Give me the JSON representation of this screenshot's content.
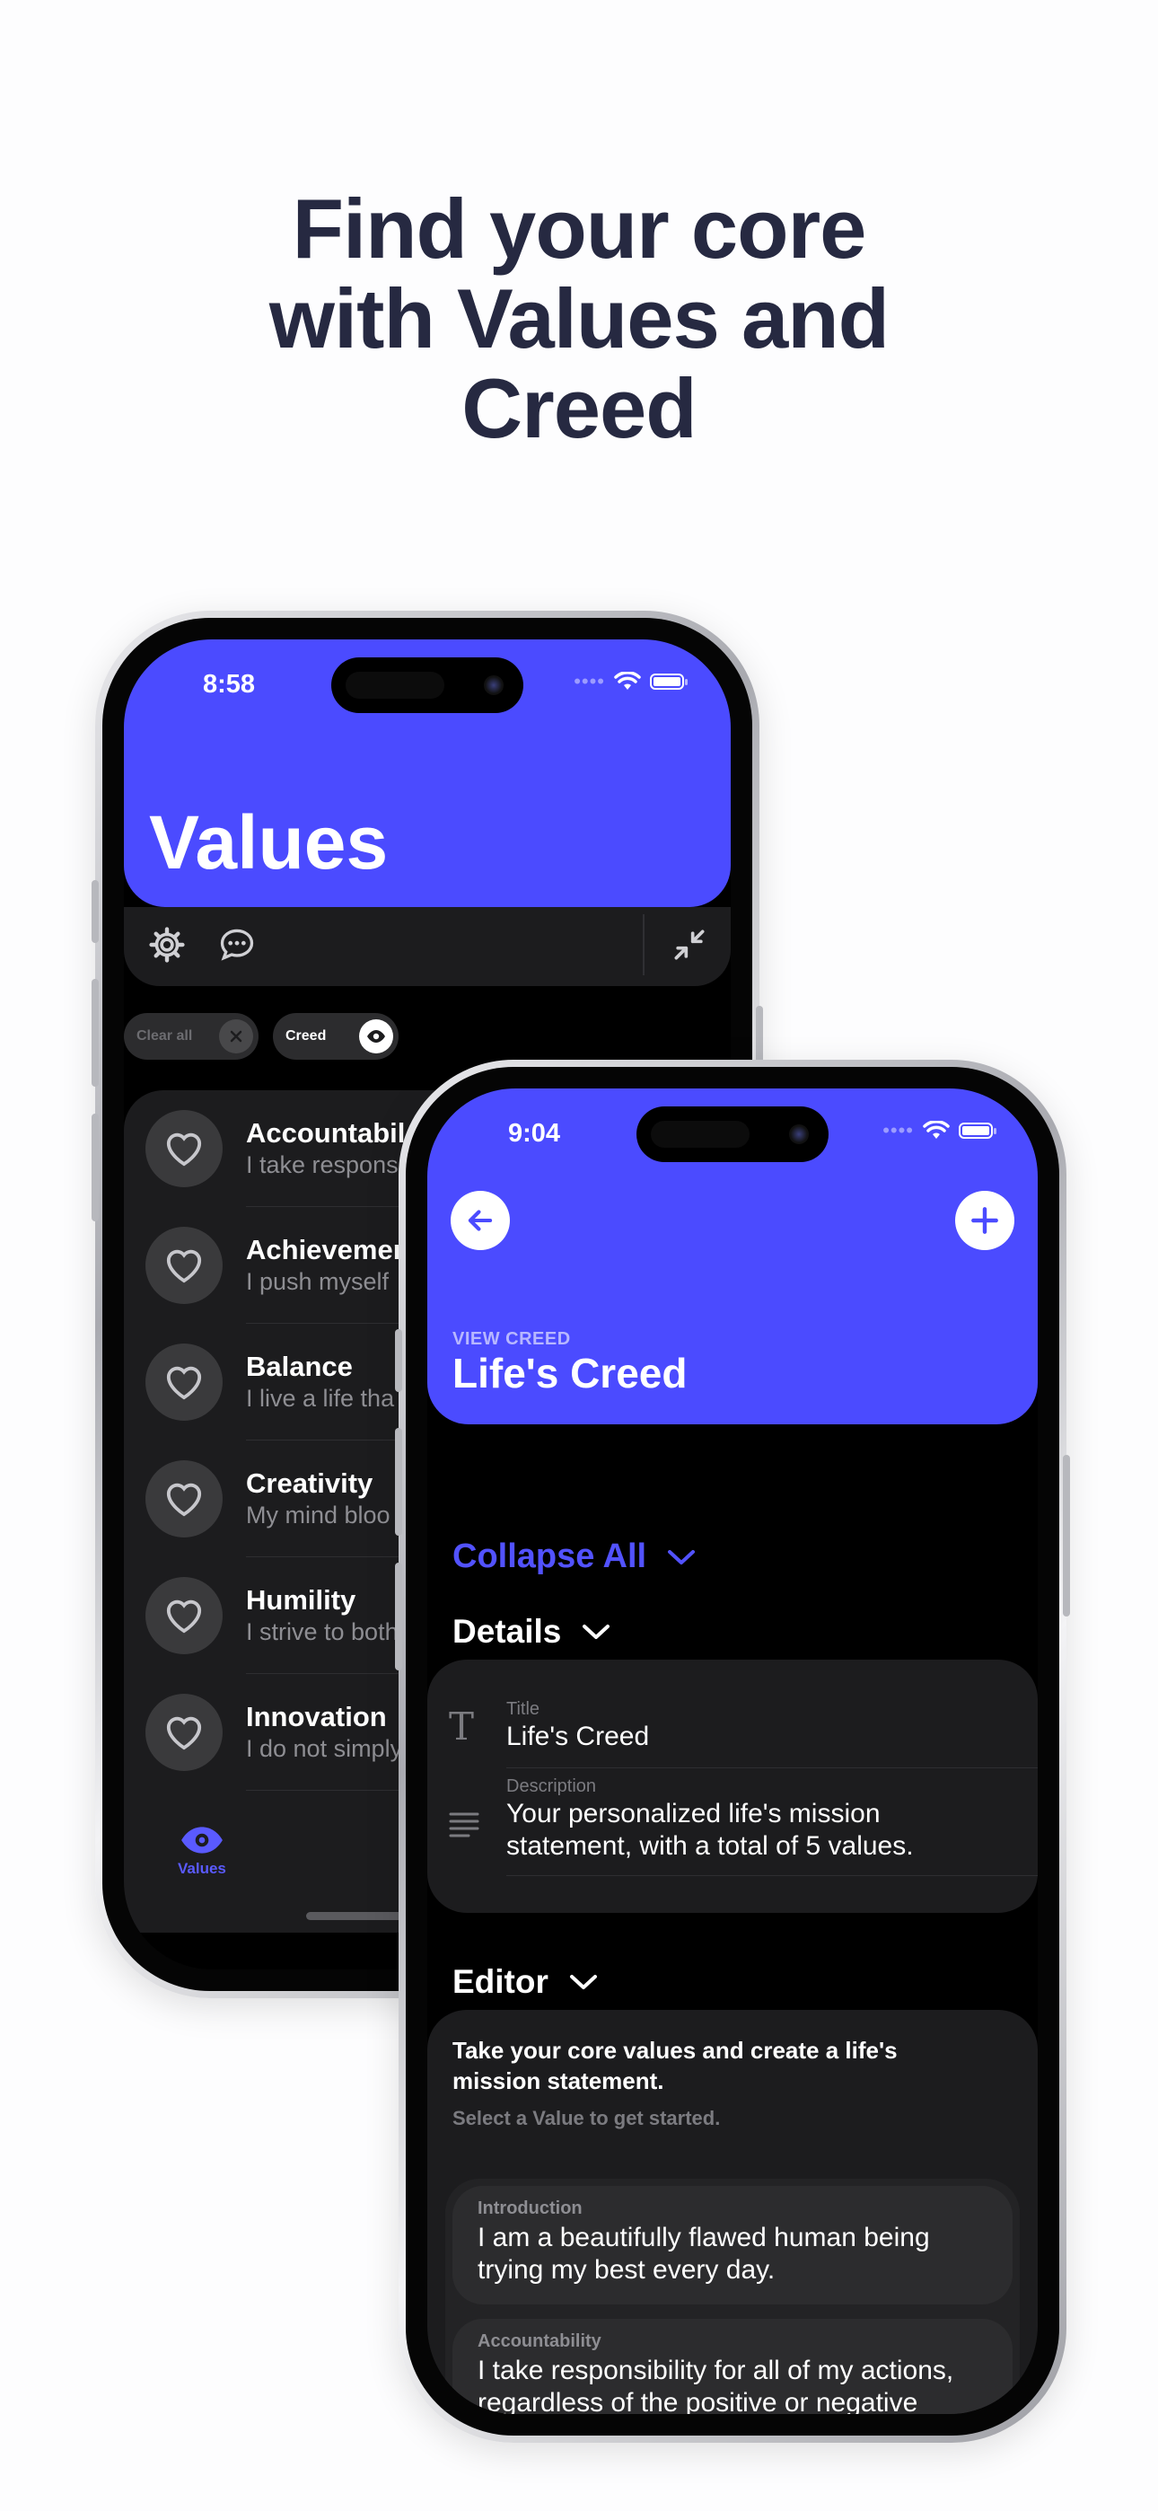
{
  "headline": {
    "line1": "Find your core",
    "line2": "with Values and",
    "line3": "Creed"
  },
  "phone1": {
    "status_time": "8:58",
    "title": "Values",
    "chips": {
      "clear_all": "Clear all",
      "creed": "Creed"
    },
    "list_items": [
      {
        "title": "Accountabil",
        "subtitle": "I take respons"
      },
      {
        "title": "Achievemen",
        "subtitle": "I push myself"
      },
      {
        "title": "Balance",
        "subtitle": "I live a life tha"
      },
      {
        "title": "Creativity",
        "subtitle": "My mind bloo"
      },
      {
        "title": "Humility",
        "subtitle": "I strive to both"
      },
      {
        "title": "Innovation",
        "subtitle": "I do not simply"
      }
    ],
    "tab_values": "Values"
  },
  "phone2": {
    "status_time": "9:04",
    "overline": "VIEW CREED",
    "title": "Life's Creed",
    "collapse_all": "Collapse All",
    "details": {
      "heading": "Details",
      "title_label": "Title",
      "title_value": "Life's Creed",
      "description_label": "Description",
      "description_value": "Your personalized life's mission statement, with a total of 5 values."
    },
    "editor": {
      "heading": "Editor",
      "instruction": "Take your core values and create a life's mission statement.",
      "hint": "Select a Value to get started.",
      "entries": [
        {
          "label": "Introduction",
          "text": "I am a beautifully flawed human being trying my best every day."
        },
        {
          "label": "Accountability",
          "text": "I take responsibility for all of my actions, regardless of the positive or negative"
        }
      ]
    }
  },
  "colors": {
    "brand": "#4b4bff",
    "headline": "#262941",
    "card": "#1c1c1e"
  }
}
